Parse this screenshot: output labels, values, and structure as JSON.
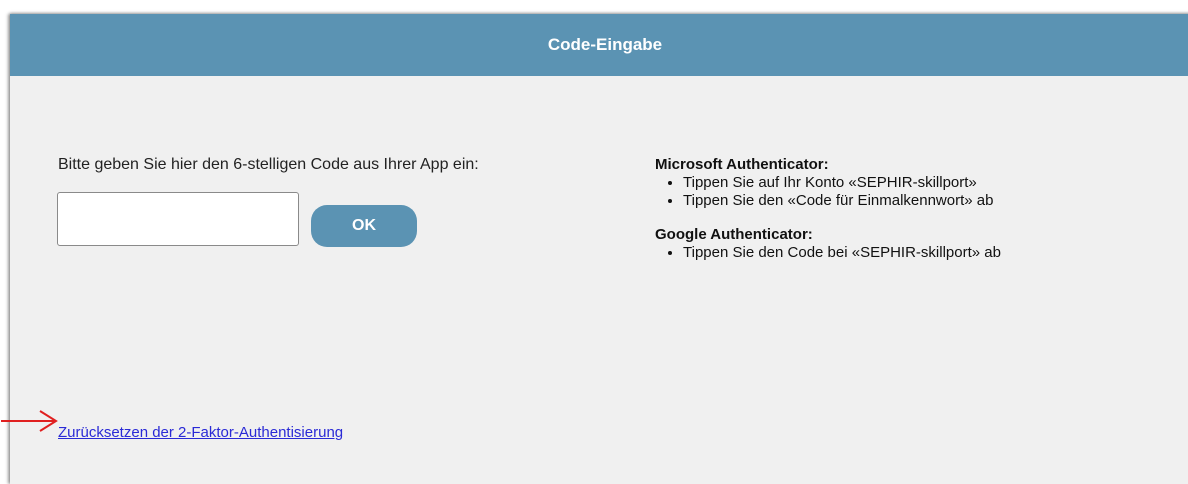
{
  "dialog": {
    "title": "Code-Eingabe"
  },
  "code_entry": {
    "instruction": "Bitte geben Sie hier den 6-stelligen Code aus Ihrer App ein:",
    "input_value": "",
    "ok_label": "OK"
  },
  "help": {
    "sections": [
      {
        "heading": "Microsoft Authenticator:",
        "items": [
          "Tippen Sie auf Ihr Konto «SEPHIR-skillport»",
          "Tippen Sie den «Code für Einmalkennwort» ab"
        ]
      },
      {
        "heading": "Google Authenticator:",
        "items": [
          "Tippen Sie den Code bei «SEPHIR-skillport» ab"
        ]
      }
    ]
  },
  "reset_link": {
    "label": "Zurücksetzen der 2-Faktor-Authentisierung"
  },
  "colors": {
    "header": "#5b93b3",
    "background": "#f0f0f0",
    "link": "#2a2ad6",
    "annotation_arrow": "#e02020"
  },
  "icons": {
    "annotation": "red-arrow-icon"
  }
}
